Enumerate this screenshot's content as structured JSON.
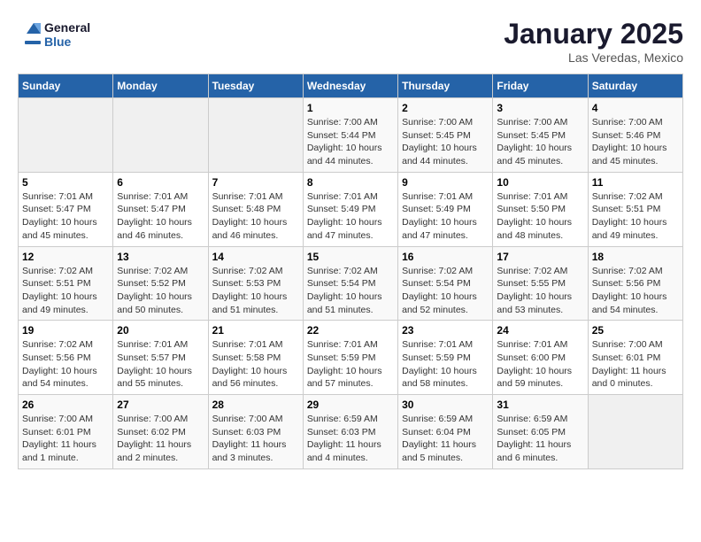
{
  "logo": {
    "line1": "General",
    "line2": "Blue"
  },
  "title": "January 2025",
  "location": "Las Veredas, Mexico",
  "days_of_week": [
    "Sunday",
    "Monday",
    "Tuesday",
    "Wednesday",
    "Thursday",
    "Friday",
    "Saturday"
  ],
  "weeks": [
    [
      {
        "day": "",
        "info": ""
      },
      {
        "day": "",
        "info": ""
      },
      {
        "day": "",
        "info": ""
      },
      {
        "day": "1",
        "info": "Sunrise: 7:00 AM\nSunset: 5:44 PM\nDaylight: 10 hours\nand 44 minutes."
      },
      {
        "day": "2",
        "info": "Sunrise: 7:00 AM\nSunset: 5:45 PM\nDaylight: 10 hours\nand 44 minutes."
      },
      {
        "day": "3",
        "info": "Sunrise: 7:00 AM\nSunset: 5:45 PM\nDaylight: 10 hours\nand 45 minutes."
      },
      {
        "day": "4",
        "info": "Sunrise: 7:00 AM\nSunset: 5:46 PM\nDaylight: 10 hours\nand 45 minutes."
      }
    ],
    [
      {
        "day": "5",
        "info": "Sunrise: 7:01 AM\nSunset: 5:47 PM\nDaylight: 10 hours\nand 45 minutes."
      },
      {
        "day": "6",
        "info": "Sunrise: 7:01 AM\nSunset: 5:47 PM\nDaylight: 10 hours\nand 46 minutes."
      },
      {
        "day": "7",
        "info": "Sunrise: 7:01 AM\nSunset: 5:48 PM\nDaylight: 10 hours\nand 46 minutes."
      },
      {
        "day": "8",
        "info": "Sunrise: 7:01 AM\nSunset: 5:49 PM\nDaylight: 10 hours\nand 47 minutes."
      },
      {
        "day": "9",
        "info": "Sunrise: 7:01 AM\nSunset: 5:49 PM\nDaylight: 10 hours\nand 47 minutes."
      },
      {
        "day": "10",
        "info": "Sunrise: 7:01 AM\nSunset: 5:50 PM\nDaylight: 10 hours\nand 48 minutes."
      },
      {
        "day": "11",
        "info": "Sunrise: 7:02 AM\nSunset: 5:51 PM\nDaylight: 10 hours\nand 49 minutes."
      }
    ],
    [
      {
        "day": "12",
        "info": "Sunrise: 7:02 AM\nSunset: 5:51 PM\nDaylight: 10 hours\nand 49 minutes."
      },
      {
        "day": "13",
        "info": "Sunrise: 7:02 AM\nSunset: 5:52 PM\nDaylight: 10 hours\nand 50 minutes."
      },
      {
        "day": "14",
        "info": "Sunrise: 7:02 AM\nSunset: 5:53 PM\nDaylight: 10 hours\nand 51 minutes."
      },
      {
        "day": "15",
        "info": "Sunrise: 7:02 AM\nSunset: 5:54 PM\nDaylight: 10 hours\nand 51 minutes."
      },
      {
        "day": "16",
        "info": "Sunrise: 7:02 AM\nSunset: 5:54 PM\nDaylight: 10 hours\nand 52 minutes."
      },
      {
        "day": "17",
        "info": "Sunrise: 7:02 AM\nSunset: 5:55 PM\nDaylight: 10 hours\nand 53 minutes."
      },
      {
        "day": "18",
        "info": "Sunrise: 7:02 AM\nSunset: 5:56 PM\nDaylight: 10 hours\nand 54 minutes."
      }
    ],
    [
      {
        "day": "19",
        "info": "Sunrise: 7:02 AM\nSunset: 5:56 PM\nDaylight: 10 hours\nand 54 minutes."
      },
      {
        "day": "20",
        "info": "Sunrise: 7:01 AM\nSunset: 5:57 PM\nDaylight: 10 hours\nand 55 minutes."
      },
      {
        "day": "21",
        "info": "Sunrise: 7:01 AM\nSunset: 5:58 PM\nDaylight: 10 hours\nand 56 minutes."
      },
      {
        "day": "22",
        "info": "Sunrise: 7:01 AM\nSunset: 5:59 PM\nDaylight: 10 hours\nand 57 minutes."
      },
      {
        "day": "23",
        "info": "Sunrise: 7:01 AM\nSunset: 5:59 PM\nDaylight: 10 hours\nand 58 minutes."
      },
      {
        "day": "24",
        "info": "Sunrise: 7:01 AM\nSunset: 6:00 PM\nDaylight: 10 hours\nand 59 minutes."
      },
      {
        "day": "25",
        "info": "Sunrise: 7:00 AM\nSunset: 6:01 PM\nDaylight: 11 hours\nand 0 minutes."
      }
    ],
    [
      {
        "day": "26",
        "info": "Sunrise: 7:00 AM\nSunset: 6:01 PM\nDaylight: 11 hours\nand 1 minute."
      },
      {
        "day": "27",
        "info": "Sunrise: 7:00 AM\nSunset: 6:02 PM\nDaylight: 11 hours\nand 2 minutes."
      },
      {
        "day": "28",
        "info": "Sunrise: 7:00 AM\nSunset: 6:03 PM\nDaylight: 11 hours\nand 3 minutes."
      },
      {
        "day": "29",
        "info": "Sunrise: 6:59 AM\nSunset: 6:03 PM\nDaylight: 11 hours\nand 4 minutes."
      },
      {
        "day": "30",
        "info": "Sunrise: 6:59 AM\nSunset: 6:04 PM\nDaylight: 11 hours\nand 5 minutes."
      },
      {
        "day": "31",
        "info": "Sunrise: 6:59 AM\nSunset: 6:05 PM\nDaylight: 11 hours\nand 6 minutes."
      },
      {
        "day": "",
        "info": ""
      }
    ]
  ]
}
